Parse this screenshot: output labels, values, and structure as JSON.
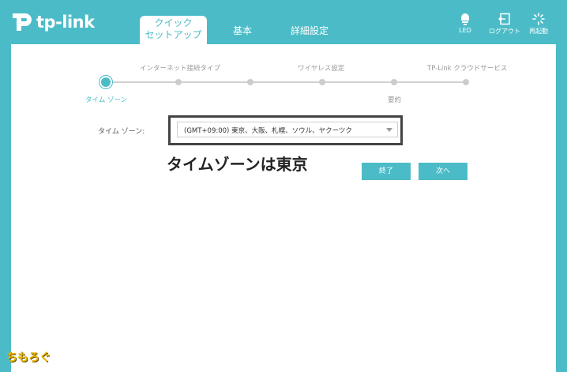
{
  "brand": {
    "logo_text": "tp-link"
  },
  "nav": {
    "tabs": [
      {
        "label_line1": "クイック",
        "label_line2": "セットアップ",
        "active": true
      },
      {
        "label": "基本"
      },
      {
        "label": "詳細設定"
      }
    ]
  },
  "header_actions": {
    "led": "LED",
    "logout": "ログアウト",
    "reboot": "再起動"
  },
  "stepper": {
    "steps": [
      {
        "label": "タイム ゾーン",
        "state": "active"
      },
      {
        "label": "インターネット接続タイプ",
        "state": "pending"
      },
      {
        "label": "",
        "state": "pending"
      },
      {
        "label": "ワイヤレス設定",
        "state": "pending"
      },
      {
        "label": "要約",
        "state": "pending"
      },
      {
        "label": "TP-Link クラウドサービス",
        "state": "pending"
      }
    ]
  },
  "timezone": {
    "label": "タイム ゾーン:",
    "selected": "(GMT+09:00) 東京、大阪、札幌、ソウル、ヤクーツク"
  },
  "annotation": "タイムゾーンは東京",
  "buttons": {
    "exit": "終了",
    "next": "次へ"
  },
  "watermark": "ちもろぐ",
  "colors": {
    "accent": "#4bbcc7",
    "panel": "#ffffff",
    "annotation_frame": "#444444"
  }
}
